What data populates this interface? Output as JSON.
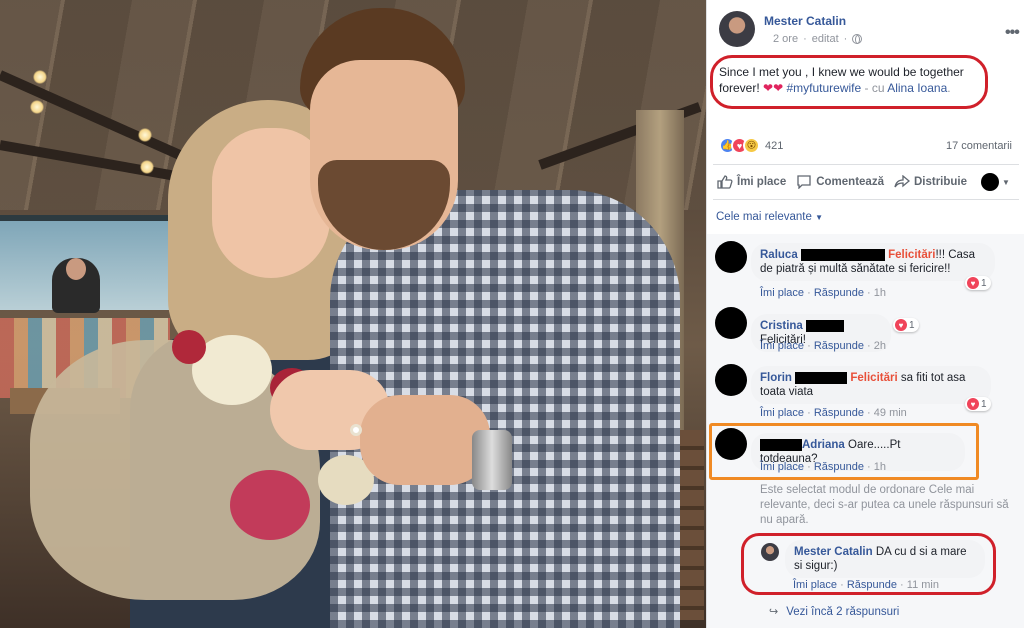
{
  "post": {
    "author": "Mester Catalin",
    "time": "2 ore",
    "edited": "editat",
    "text_before_hearts": "Since I met you , I knew we would be together forever! ",
    "hearts": "❤❤",
    "hashtag": "#myfuturewife",
    "with_label": "- cu",
    "tagged": "Alina Ioana",
    "tail": "."
  },
  "reactions": {
    "count": "421",
    "comments_count": "17 comentarii",
    "icons": [
      "like-icon",
      "love-icon",
      "wow-icon"
    ]
  },
  "actions": {
    "like": "Îmi place",
    "comment": "Comentează",
    "share": "Distribuie"
  },
  "sort": {
    "label": "Cele mai relevante"
  },
  "comments": [
    {
      "name": "Raluca",
      "highlight": "Felicitări",
      "text": "!!! Casa de piatră și multă sănătate si fericire!!",
      "like": "Îmi place",
      "reply": "Răspunde",
      "time": "1h",
      "reaction_count": "1"
    },
    {
      "name": "Cristina",
      "text": "Felicitări!",
      "like": "Îmi place",
      "reply": "Răspunde",
      "time": "2h",
      "reaction_count": "1"
    },
    {
      "name": "Florin",
      "highlight": "Felicitări",
      "text": " sa fiti tot asa toata viata",
      "like": "Îmi place",
      "reply": "Răspunde",
      "time": "49 min",
      "reaction_count": "1"
    },
    {
      "name": "Adriana",
      "text": "Oare.....Pt totdeauna?",
      "like": "Îmi place",
      "reply": "Răspunde",
      "time": "1h"
    }
  ],
  "sort_note": "Este selectat modul de ordonare Cele mai relevante, deci s-ar putea ca unele răspunsuri să nu apară.",
  "reply": {
    "name": "Mester Catalin",
    "text": "DA cu d si a mare si sigur:)",
    "like": "Îmi place",
    "reply": "Răspunde",
    "time": "11 min"
  },
  "more_replies": "Vezi încă 2 răspunsuri",
  "colors": {
    "link": "#365899",
    "highlight": "#e8503a",
    "oval": "#d0202a",
    "box": "#f08a24"
  }
}
